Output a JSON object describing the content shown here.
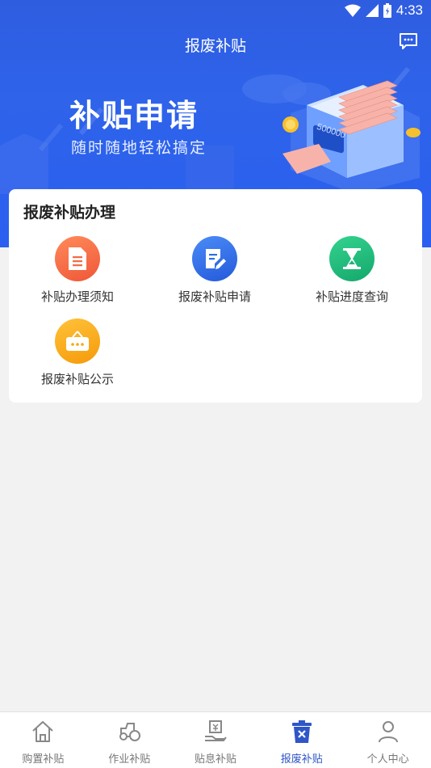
{
  "status_bar": {
    "time": "4:33"
  },
  "header": {
    "title": "报废补贴"
  },
  "banner": {
    "title": "补贴申请",
    "subtitle": "随时随地轻松搞定",
    "machine_amount": "500000"
  },
  "card": {
    "title": "报废补贴办理",
    "items": [
      {
        "label": "补贴办理须知",
        "icon": "document-icon",
        "color": "#f4683f"
      },
      {
        "label": "报废补贴申请",
        "icon": "edit-document-icon",
        "color": "#2f6fe6"
      },
      {
        "label": "补贴进度查询",
        "icon": "hourglass-icon",
        "color": "#1fb57b"
      },
      {
        "label": "报废补贴公示",
        "icon": "notice-board-icon",
        "color": "#f7a70e"
      }
    ]
  },
  "tabbar": {
    "tabs": [
      {
        "label": "购置补贴",
        "icon": "home-icon",
        "active": false
      },
      {
        "label": "作业补贴",
        "icon": "tractor-icon",
        "active": false
      },
      {
        "label": "贴息补贴",
        "icon": "hand-money-icon",
        "active": false
      },
      {
        "label": "报废补贴",
        "icon": "scrap-bin-icon",
        "active": true
      },
      {
        "label": "个人中心",
        "icon": "person-icon",
        "active": false
      }
    ]
  },
  "colors": {
    "primary": "#2f5de0",
    "active_tab": "#2f56c7"
  }
}
